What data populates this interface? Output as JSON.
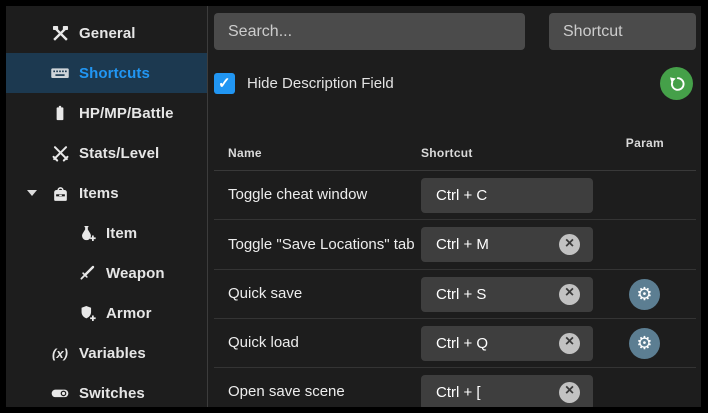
{
  "colors": {
    "accent": "#2196f3",
    "selected_item_bg": "#1c3950",
    "reset_button": "#45a049",
    "param_button": "#5c7e92"
  },
  "sidebar": {
    "items": [
      {
        "label": "General",
        "icon": "hammer-wrench-icon",
        "selected": false
      },
      {
        "label": "Shortcuts",
        "icon": "keyboard-icon",
        "selected": true
      },
      {
        "label": "HP/MP/Battle",
        "icon": "battery-icon",
        "selected": false
      },
      {
        "label": "Stats/Level",
        "icon": "crossed-swords-icon",
        "selected": false
      },
      {
        "label": "Items",
        "icon": "backpack-icon",
        "selected": false,
        "expanded": true
      },
      {
        "label": "Item",
        "icon": "flask-plus-icon",
        "selected": false,
        "child": true
      },
      {
        "label": "Weapon",
        "icon": "sword-icon",
        "selected": false,
        "child": true
      },
      {
        "label": "Armor",
        "icon": "armor-plus-icon",
        "selected": false,
        "child": true
      },
      {
        "label": "Variables",
        "icon": "variables-icon",
        "icon_glyph": "(x)",
        "selected": false
      },
      {
        "label": "Switches",
        "icon": "toggle-icon",
        "selected": false
      }
    ]
  },
  "toolbar": {
    "search_placeholder": "Search...",
    "shortcut_filter_placeholder": "Shortcut",
    "hide_description_label": "Hide Description Field",
    "hide_description_checked": true,
    "reset_icon": "restore-icon"
  },
  "table": {
    "columns": [
      "Name",
      "Shortcut",
      "Param"
    ],
    "rows": [
      {
        "name": "Toggle cheat window",
        "shortcut": "Ctrl + C",
        "clearable": false,
        "has_param": false
      },
      {
        "name": "Toggle \"Save Locations\" tab",
        "shortcut": "Ctrl + M",
        "clearable": true,
        "has_param": false
      },
      {
        "name": "Quick save",
        "shortcut": "Ctrl + S",
        "clearable": true,
        "has_param": true
      },
      {
        "name": "Quick load",
        "shortcut": "Ctrl + Q",
        "clearable": true,
        "has_param": true
      },
      {
        "name": "Open save scene",
        "shortcut": "Ctrl + [",
        "clearable": true,
        "has_param": false
      }
    ]
  }
}
